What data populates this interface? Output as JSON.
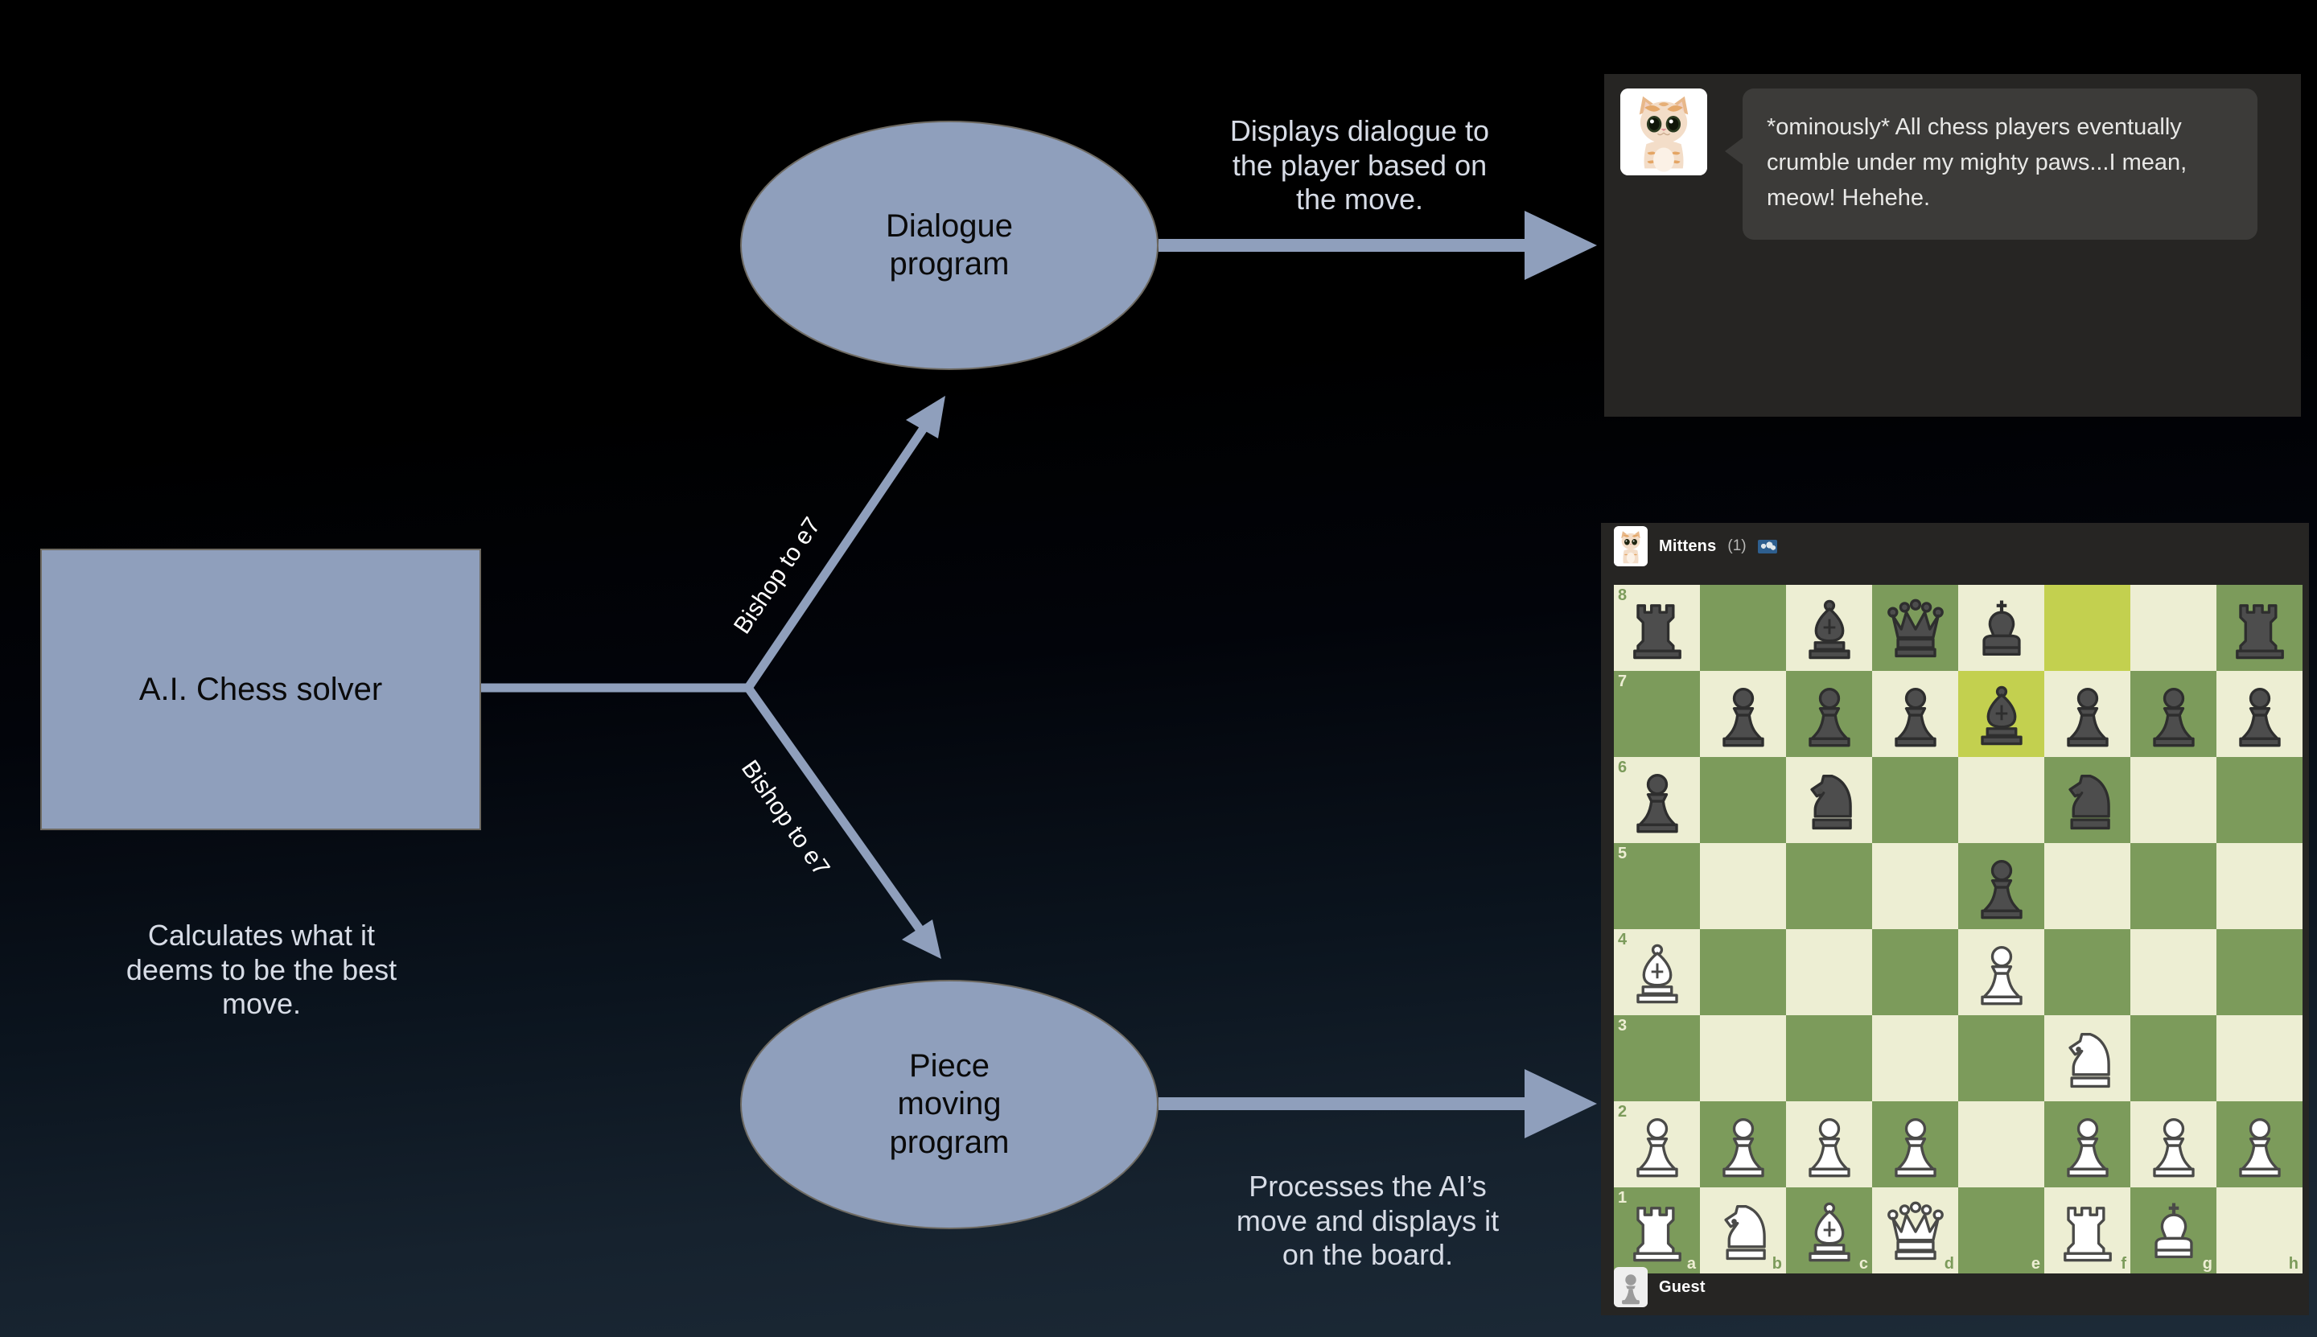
{
  "diagram": {
    "nodes": {
      "solver": {
        "label": "A.I. Chess solver"
      },
      "dialogue_program": {
        "label": "Dialogue\nprogram"
      },
      "piece_program": {
        "label": "Piece\nmoving\nprogram"
      }
    },
    "captions": {
      "solver_caption": "Calculates what it\ndeems to be the best\nmove.",
      "dialogue_caption": "Displays dialogue to\nthe player based on\nthe move.",
      "piece_caption": "Processes the AI’s\nmove and displays it\non the board."
    },
    "edge_labels": {
      "to_dialogue": "Bishop to e7",
      "to_piece": "Bishop to e7"
    },
    "colors": {
      "node_fill": "#8f9fbc",
      "node_border": "#6e6a62",
      "connector": "#8f9fbc",
      "caption_text": "#d7dce6",
      "edge_label_text": "#ffffff",
      "background_top": "#000000",
      "background_bottom": "#1d2b38"
    }
  },
  "dialogue_panel": {
    "avatar_icon": "cat-avatar-icon",
    "message": "*ominously* All chess players eventually crumble under my mighty paws...I mean, meow! Hehehe.",
    "bubble_color": "#3c3b39",
    "panel_color": "#262523"
  },
  "chess_panel": {
    "panel_color": "#262523",
    "top_player": {
      "name": "Mittens",
      "count": "(1)",
      "flag_icon": "flag-icon",
      "avatar_icon": "cat-avatar-icon"
    },
    "bottom_player": {
      "name": "Guest",
      "avatar_icon": "pawn-avatar-icon"
    },
    "board": {
      "light_square": "#edeed3",
      "dark_square": "#7c9b5b",
      "highlight_square": "#c3d04f",
      "rank_labels": [
        "8",
        "7",
        "6",
        "5",
        "4",
        "3",
        "2",
        "1"
      ],
      "file_labels": [
        "a",
        "b",
        "c",
        "d",
        "e",
        "f",
        "g",
        "h"
      ],
      "highlighted_squares": [
        "f8",
        "e7"
      ],
      "orientation": "white-bottom",
      "position": [
        [
          "br",
          "",
          "bb",
          "bq",
          "bk",
          "",
          "",
          "br"
        ],
        [
          "",
          "bp",
          "bp",
          "bp",
          "bb",
          "bp",
          "bp",
          "bp"
        ],
        [
          "bp",
          "",
          "bn",
          "",
          "",
          "bn",
          "",
          ""
        ],
        [
          "",
          "",
          "",
          "",
          "bp",
          "",
          "",
          ""
        ],
        [
          "wb",
          "",
          "",
          "",
          "wp",
          "",
          "",
          ""
        ],
        [
          "",
          "",
          "",
          "",
          "",
          "wn",
          "",
          ""
        ],
        [
          "wp",
          "wp",
          "wp",
          "wp",
          "",
          "wp",
          "wp",
          "wp"
        ],
        [
          "wr",
          "wn",
          "wb",
          "wq",
          "",
          "wr",
          "wk",
          ""
        ]
      ]
    }
  }
}
